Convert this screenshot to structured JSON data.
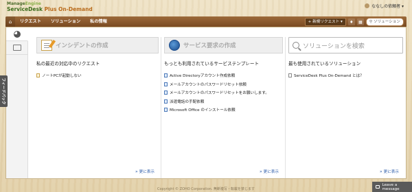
{
  "header": {
    "brand_top_a": "Manage",
    "brand_top_b": "Engine",
    "brand_main_a": "ServiceDesk",
    "brand_main_b": " Plus On-Demand",
    "user_name": "ななしの依頼者 ▾"
  },
  "nav": {
    "home_icon": "home-icon",
    "items": [
      "リクエスト",
      "ソリューション",
      "私の情報"
    ],
    "new_request": "+ 新規リクエスト ▾",
    "solution_search": "ソリューション"
  },
  "actions": {
    "incident": "インシデントの作成",
    "service": "サービス要求の作成",
    "solution_search_placeholder": "ソリューションを検索"
  },
  "col1": {
    "title": "私の最近の対応中のリクエスト",
    "items": [
      "ノートPCが起動しない"
    ],
    "more": "更に表示"
  },
  "col2": {
    "title": "もっとも利用されているサービステンプレート",
    "items": [
      "Active Directoryアカウント作成依頼",
      "メールアカウントのパスワードリセット依頼",
      "メールアカウントのパスワードリセットをお願いします。",
      "派遣電話の手配依頼",
      "Microsoft Office のインストール依頼"
    ],
    "more": "更に表示"
  },
  "col3": {
    "title": "最も使用されているソリューション",
    "items": [
      "ServiceDesk Plus On-Demand とは？"
    ],
    "more": "更に表示"
  },
  "feedback": "フィードバック",
  "footer": "Copyright © ZOHO Corporation. 無断複写・転載を禁じます",
  "leave_message": "Leave a message"
}
